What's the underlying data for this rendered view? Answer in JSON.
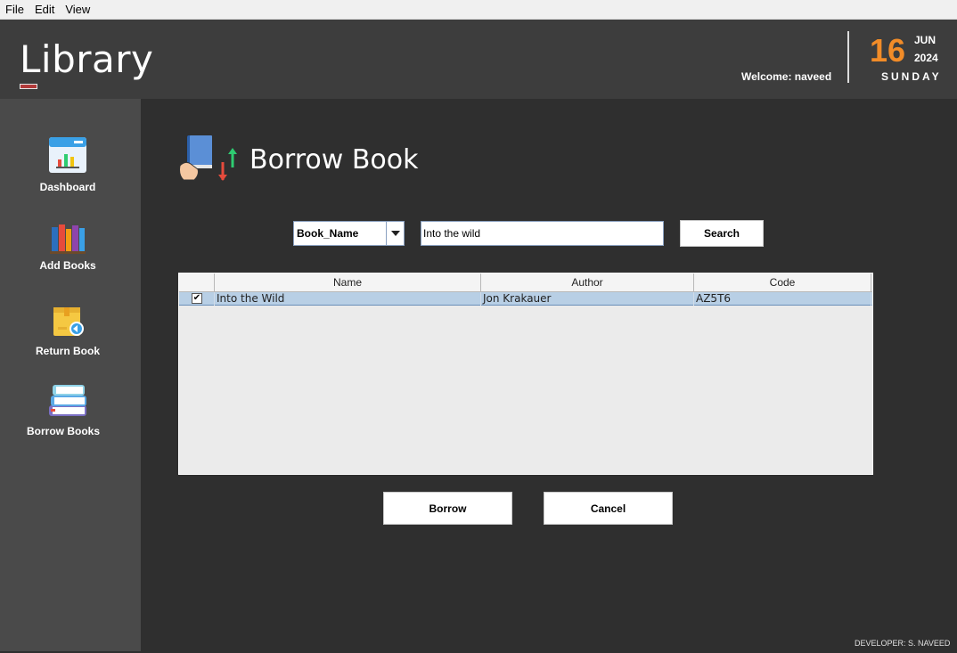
{
  "menu": {
    "file": "File",
    "edit": "Edit",
    "view": "View"
  },
  "header": {
    "logo": "Library",
    "welcome": "Welcome: naveed",
    "date": {
      "day": "16",
      "month": "JUN",
      "year": "2024",
      "weekday": "SUNDAY"
    }
  },
  "sidebar": {
    "items": [
      {
        "label": "Dashboard",
        "icon": "dashboard-icon"
      },
      {
        "label": "Add Books",
        "icon": "books-icon"
      },
      {
        "label": "Return Book",
        "icon": "return-box-icon"
      },
      {
        "label": "Borrow Books",
        "icon": "book-stack-icon"
      }
    ]
  },
  "main": {
    "title": "Borrow Book",
    "filter": {
      "selected": "Book_Name"
    },
    "search": {
      "value": "Into the wild",
      "button": "Search"
    },
    "table": {
      "columns": [
        "",
        "Name",
        "Author",
        "Code"
      ],
      "rows": [
        {
          "checked": true,
          "name": "Into the Wild",
          "author": "Jon Krakauer",
          "code": "AZ5T6"
        }
      ]
    },
    "borrow_button": "Borrow",
    "cancel_button": "Cancel"
  },
  "footer": "DEVELOPER: S. NAVEED",
  "colors": {
    "accent": "#f28c28",
    "sidebar": "#4a4a4a",
    "header": "#3d3d3d",
    "main": "#2f2f2f",
    "selected_row": "#b8cfe5"
  }
}
